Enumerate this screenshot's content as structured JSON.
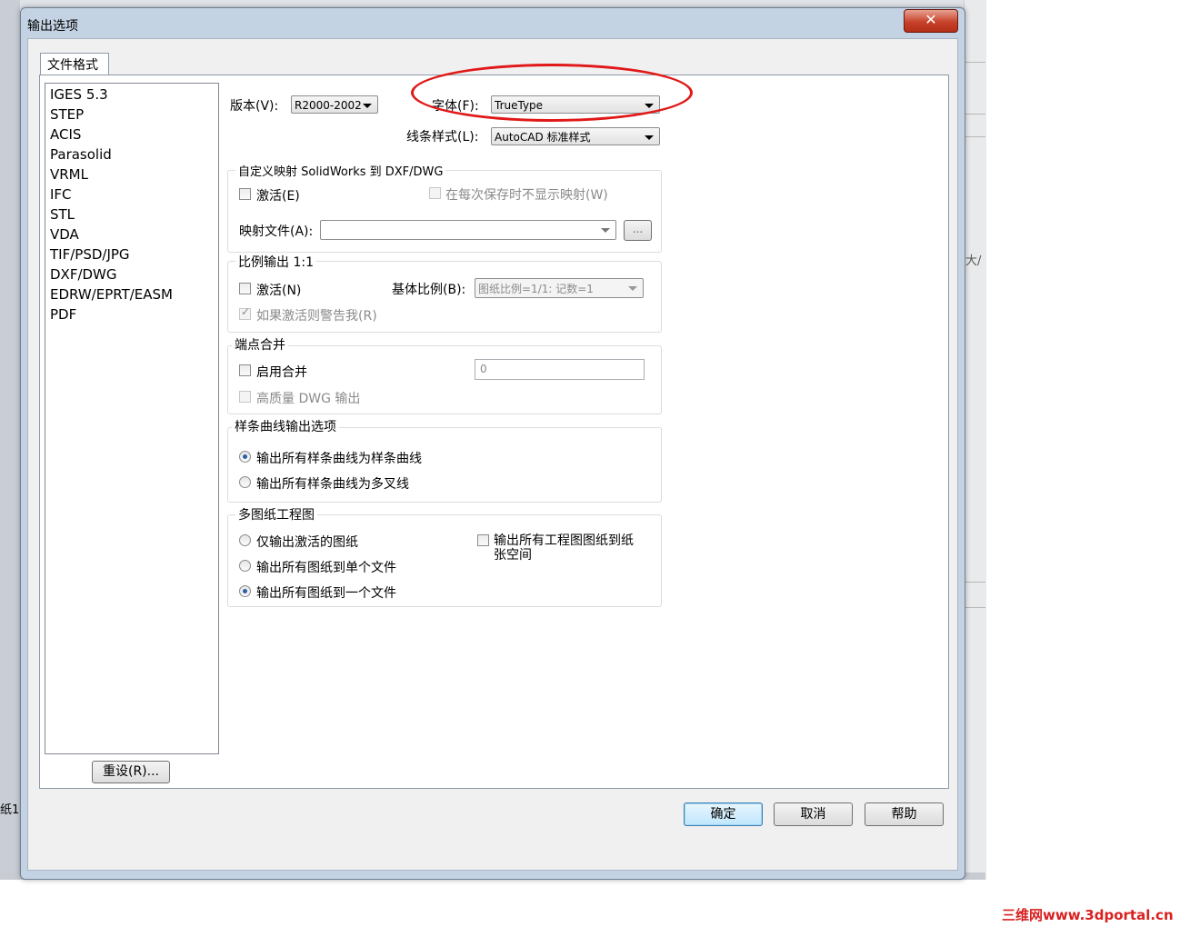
{
  "window": {
    "title": "输出选项",
    "close_symbol": "✕"
  },
  "tabs": [
    {
      "label": "文件格式"
    }
  ],
  "formats": [
    "IGES 5.3",
    "STEP",
    "ACIS",
    "Parasolid",
    "VRML",
    "IFC",
    "STL",
    "VDA",
    "TIF/PSD/JPG",
    "DXF/DWG",
    "EDRW/EPRT/EASM",
    "PDF"
  ],
  "selected_format": "DXF/DWG",
  "reset_button": "重设(R)...",
  "version": {
    "label": "版本(V):",
    "value": "R2000-2002"
  },
  "font": {
    "label": "字体(F):",
    "value": "TrueType"
  },
  "linestyle": {
    "label": "线条样式(L):",
    "value": "AutoCAD 标准样式"
  },
  "custom_map": {
    "title": "自定义映射 SolidWorks 到 DXF/DWG",
    "activate": "激活(E)",
    "no_show": "在每次保存时不显示映射(W)",
    "map_file_label": "映射文件(A):",
    "map_file_value": "",
    "browse": "..."
  },
  "scale": {
    "title": "比例输出 1:1",
    "activate": "激活(N)",
    "base_label": "基体比例(B):",
    "base_value": "图纸比例=1/1: 记数=1",
    "warn": "如果激活则警告我(R)"
  },
  "endpoint": {
    "title": "端点合并",
    "enable": "启用合并",
    "value": "0",
    "hq": "高质量 DWG 输出"
  },
  "spline": {
    "title": "样条曲线输出选项",
    "opt1": "输出所有样条曲线为样条曲线",
    "opt2": "输出所有样条曲线为多叉线"
  },
  "multi": {
    "title": "多图纸工程图",
    "opt1": "仅输出激活的图纸",
    "opt2": "输出所有图纸到单个文件",
    "opt3": "输出所有图纸到一个文件",
    "paper_line1": "输出所有工程图图纸到纸",
    "paper_line2": "张空间"
  },
  "buttons": {
    "ok": "确定",
    "cancel": "取消",
    "help": "帮助"
  },
  "background": {
    "right_text": "大/",
    "left_text": "纸1"
  },
  "watermark": "三维网www.3dportal.cn",
  "colors": {
    "accent_red": "#e01818",
    "dialog_frame": "#c4d3e4",
    "radio_dot": "#2a5fa8"
  }
}
